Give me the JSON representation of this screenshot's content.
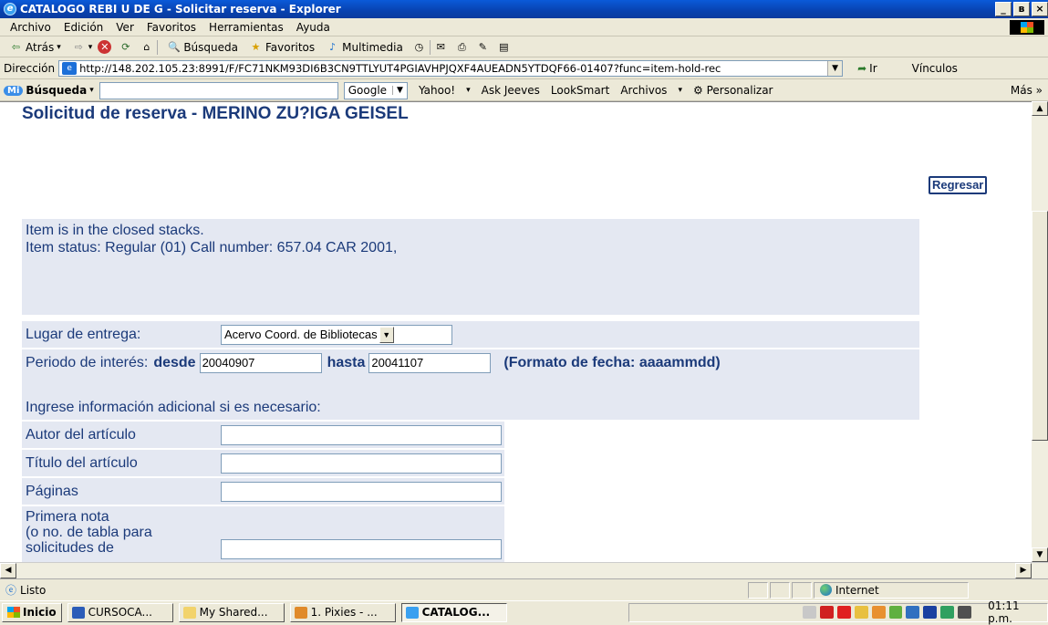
{
  "window": {
    "title": "CATALOGO REBI U DE G - Solicitar reserva - Explorer",
    "minimize": "_",
    "maximize": "ʙ",
    "close": "×"
  },
  "menu": [
    "Archivo",
    "Edición",
    "Ver",
    "Favoritos",
    "Herramientas",
    "Ayuda"
  ],
  "toolbar": {
    "back": "Atrás",
    "search": "Búsqueda",
    "favorites": "Favoritos",
    "media": "Multimedia"
  },
  "address": {
    "label": "Dirección",
    "url": "http://148.202.105.23:8991/F/FC71NKM93DI6B3CN9TTLYUT4PGIAVHPJQXF4AUEADN5YTDQF66-01407?func=item-hold-rec",
    "go": "Ir",
    "links": "Vínculos"
  },
  "search_toolbar": {
    "brand": "Mi",
    "label": "Búsqueda",
    "google": "Google",
    "items": [
      "Yahoo!",
      "Ask Jeeves",
      "LookSmart",
      "Archivos",
      "Personalizar"
    ],
    "more": "Más"
  },
  "page": {
    "title": "Solicitud de reserva - MERINO ZU?IGA GEISEL",
    "back_button": "Regresar",
    "info_line1": "Item is in the closed stacks.",
    "info_line2": "Item status: Regular (01) Call number: 657.04 CAR 2001,",
    "pickup_label": "Lugar de entrega:",
    "pickup_value": "Acervo Coord. de Bibliotecas",
    "period_label": "Periodo de interés:",
    "from_label": "desde",
    "from_value": "20040907",
    "to_label": "hasta",
    "to_value": "20041107",
    "date_format": "(Formato de fecha: aaaammdd)",
    "additional_info": "Ingrese información adicional si es necesario:",
    "author_label": "Autor del artículo",
    "article_title_label": "Título del artículo",
    "pages_label": "Páginas",
    "note_label_1": "Primera nota",
    "note_label_2": "(o no. de tabla para",
    "note_label_3": "solicitudes de"
  },
  "status": {
    "text": "Listo",
    "zone": "Internet"
  },
  "taskbar": {
    "start": "Inicio",
    "tasks": [
      "CURSOCA...",
      "My Shared...",
      "1. Pixies - ...",
      "CATALOG..."
    ],
    "clock": "01:11 p.m."
  },
  "colors": {
    "title_bar": "#0842b0",
    "page_text": "#1b3a7a",
    "panel_bg": "#e4e8f2",
    "chrome_bg": "#ece9d8"
  }
}
